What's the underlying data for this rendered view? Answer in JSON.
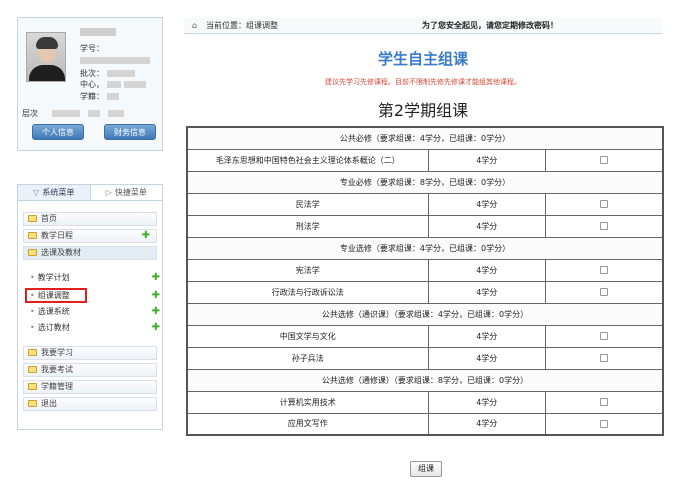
{
  "profile": {
    "student_no_label": "学号：",
    "batch_label": "批次：",
    "center_label": "中心，",
    "status_label": "学籍：",
    "level_label": "层次",
    "btn_personal": "个人信息",
    "btn_finance": "财务信息"
  },
  "menu": {
    "tab_system": "系统菜单",
    "tab_quick": "快捷菜单",
    "items": [
      {
        "label": "首页",
        "plus": false
      },
      {
        "label": "教学日程",
        "plus": true
      },
      {
        "label": "选课及教材",
        "plus": false
      }
    ],
    "subitems": [
      {
        "label": "教学计划",
        "plus": true
      },
      {
        "label": "组课调整",
        "plus": true
      },
      {
        "label": "选课系统",
        "plus": true
      },
      {
        "label": "选订教材",
        "plus": true
      }
    ],
    "bottom_items": [
      {
        "label": "我要学习"
      },
      {
        "label": "我要考试"
      },
      {
        "label": "学籍管理"
      },
      {
        "label": "退出"
      }
    ],
    "plus_glyph": "✚"
  },
  "topbar": {
    "location": "当前位置：组课调整",
    "notice": "为了您安全起见，请您定期修改密码！"
  },
  "main": {
    "title": "学生自主组课",
    "tip": "建议先学习先修课程。目前不限制先修先修课才能组其他课程。",
    "term": "第2学期组课",
    "submit_label": "组课"
  },
  "table": {
    "groups": [
      {
        "header": "公共必修（要求组课：4学分，已组课：0学分）",
        "courses": [
          {
            "name": "毛泽东思想和中国特色社会主义理论体系概论（二）",
            "credit": "4学分"
          }
        ]
      },
      {
        "header": "专业必修（要求组课：8学分，已组课：0学分）",
        "courses": [
          {
            "name": "民法学",
            "credit": "4学分"
          },
          {
            "name": "刑法学",
            "credit": "4学分"
          }
        ]
      },
      {
        "header": "专业选修（要求组课：4学分，已组课：0学分）",
        "courses": [
          {
            "name": "宪法学",
            "credit": "4学分"
          },
          {
            "name": "行政法与行政诉讼法",
            "credit": "4学分"
          }
        ]
      },
      {
        "header": "公共选修（通识课）（要求组课：4学分，已组课：0学分）",
        "courses": [
          {
            "name": "中国文学与文化",
            "credit": "4学分"
          },
          {
            "name": "孙子兵法",
            "credit": "4学分"
          }
        ]
      },
      {
        "header": "公共选修（通修课）（要求组课：8学分，已组课：0学分）",
        "courses": [
          {
            "name": "计算机实用技术",
            "credit": "4学分"
          },
          {
            "name": "应用文写作",
            "credit": "4学分"
          }
        ]
      }
    ]
  }
}
